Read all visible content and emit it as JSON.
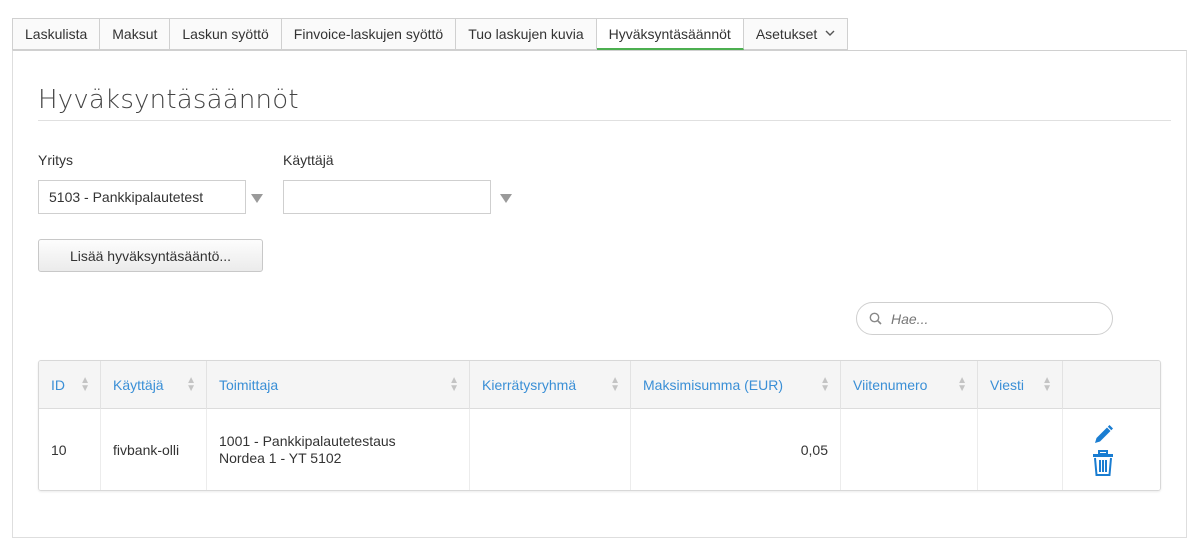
{
  "tabs": [
    {
      "label": "Laskulista"
    },
    {
      "label": "Maksut"
    },
    {
      "label": "Laskun syöttö"
    },
    {
      "label": "Finvoice-laskujen syöttö"
    },
    {
      "label": "Tuo laskujen kuvia"
    },
    {
      "label": "Hyväksyntäsäännöt",
      "active": true
    },
    {
      "label": "Asetukset",
      "dropdown": true
    }
  ],
  "page": {
    "title": "Hyväksyntäsäännöt"
  },
  "filters": {
    "company_label": "Yritys",
    "company_value": "5103 - Pankkipalautetest",
    "user_label": "Käyttäjä",
    "user_value": ""
  },
  "actions": {
    "add_rule_label": "Lisää hyväksyntäsääntö..."
  },
  "search": {
    "placeholder": "Hae..."
  },
  "table": {
    "columns": [
      "ID",
      "Käyttäjä",
      "Toimittaja",
      "Kierrätysryhmä",
      "Maksimisumma (EUR)",
      "Viitenumero",
      "Viesti"
    ],
    "rows": [
      {
        "id": "10",
        "user": "fivbank-olli",
        "supplier_line1": "1001 - Pankkipalautetestaus",
        "supplier_line2": "Nordea 1 - YT 5102",
        "group": "",
        "max_sum": "0,05",
        "reference": "",
        "message": ""
      }
    ]
  },
  "colors": {
    "accent_green": "#4caf50",
    "link_blue": "#3a8fd6",
    "icon_blue": "#1a7dd1"
  },
  "icons": {
    "search": "magnifier-icon",
    "edit": "pencil-icon",
    "delete": "trash-icon",
    "dropdown": "chevron-down-icon"
  }
}
